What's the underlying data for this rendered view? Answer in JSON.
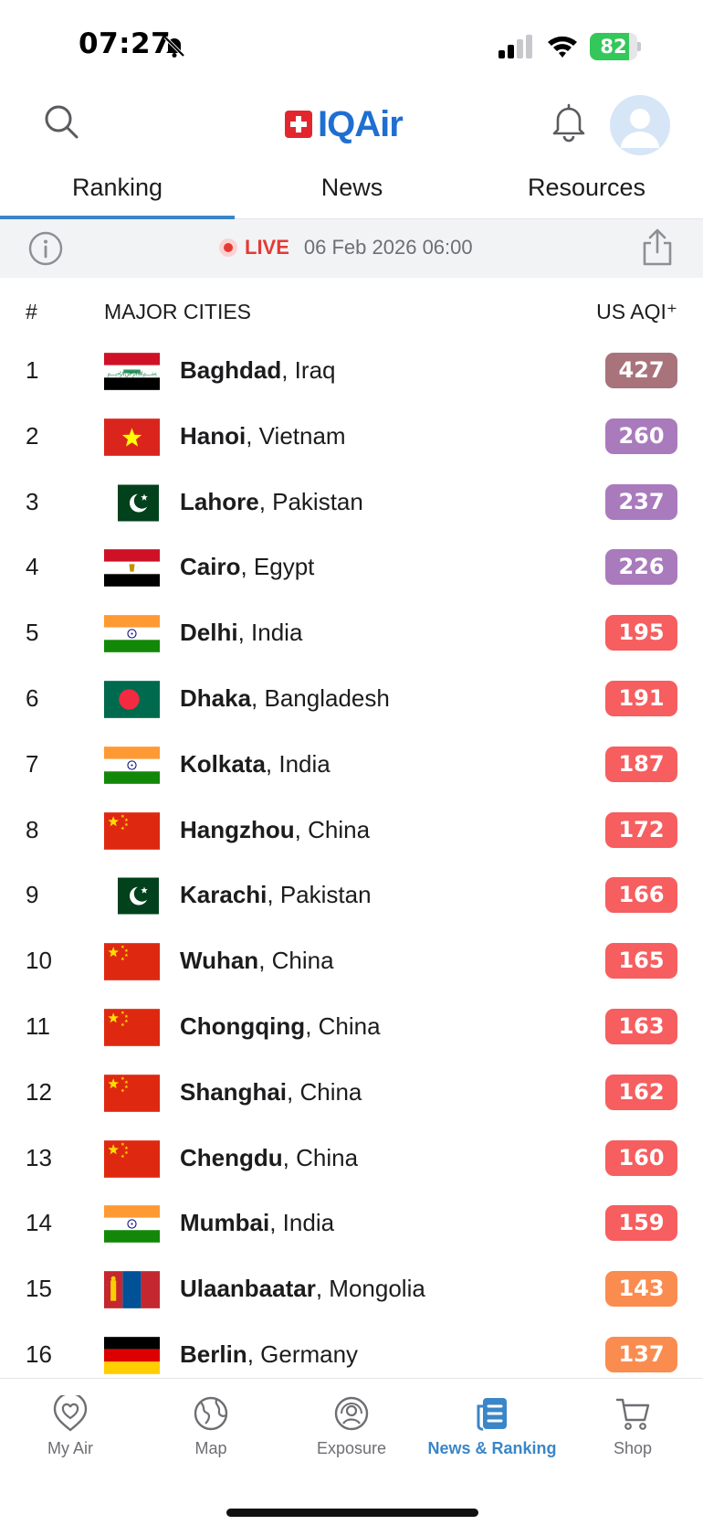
{
  "status_bar": {
    "time": "07:27",
    "battery": "82",
    "battery_level": 0.82,
    "icons": [
      "bell-slash-icon",
      "signal-icon",
      "wifi-icon",
      "battery-icon"
    ]
  },
  "header": {
    "logo_text": "IQAir",
    "icons": [
      "search-icon",
      "bell-icon",
      "avatar-icon"
    ]
  },
  "tabs": [
    {
      "label": "Ranking",
      "active": true
    },
    {
      "label": "News",
      "active": false
    },
    {
      "label": "Resources",
      "active": false
    }
  ],
  "live_bar": {
    "live_label": "LIVE",
    "datetime": "06 Feb 2026 06:00"
  },
  "table": {
    "col_rank": "#",
    "col_city": "MAJOR CITIES",
    "col_aqi": "US AQI⁺",
    "rows": [
      {
        "rank": "1",
        "city": "Baghdad",
        "country": ", Iraq",
        "aqi": "427",
        "color": "#a8737b",
        "flag": "iraq"
      },
      {
        "rank": "2",
        "city": "Hanoi",
        "country": ", Vietnam",
        "aqi": "260",
        "color": "#a97abc",
        "flag": "vietnam"
      },
      {
        "rank": "3",
        "city": "Lahore",
        "country": ", Pakistan",
        "aqi": "237",
        "color": "#a97abc",
        "flag": "pakistan"
      },
      {
        "rank": "4",
        "city": "Cairo",
        "country": ", Egypt",
        "aqi": "226",
        "color": "#a97abc",
        "flag": "egypt"
      },
      {
        "rank": "5",
        "city": "Delhi",
        "country": ", India",
        "aqi": "195",
        "color": "#f65e5f",
        "flag": "india"
      },
      {
        "rank": "6",
        "city": "Dhaka",
        "country": ", Bangladesh",
        "aqi": "191",
        "color": "#f65e5f",
        "flag": "bangladesh"
      },
      {
        "rank": "7",
        "city": "Kolkata",
        "country": ", India",
        "aqi": "187",
        "color": "#f65e5f",
        "flag": "india"
      },
      {
        "rank": "8",
        "city": "Hangzhou",
        "country": ", China",
        "aqi": "172",
        "color": "#f65e5f",
        "flag": "china"
      },
      {
        "rank": "9",
        "city": "Karachi",
        "country": ", Pakistan",
        "aqi": "166",
        "color": "#f65e5f",
        "flag": "pakistan"
      },
      {
        "rank": "10",
        "city": "Wuhan",
        "country": ", China",
        "aqi": "165",
        "color": "#f65e5f",
        "flag": "china"
      },
      {
        "rank": "11",
        "city": "Chongqing",
        "country": ", China",
        "aqi": "163",
        "color": "#f65e5f",
        "flag": "china"
      },
      {
        "rank": "12",
        "city": "Shanghai",
        "country": ", China",
        "aqi": "162",
        "color": "#f65e5f",
        "flag": "china"
      },
      {
        "rank": "13",
        "city": "Chengdu",
        "country": ", China",
        "aqi": "160",
        "color": "#f65e5f",
        "flag": "china"
      },
      {
        "rank": "14",
        "city": "Mumbai",
        "country": ", India",
        "aqi": "159",
        "color": "#f65e5f",
        "flag": "india"
      },
      {
        "rank": "15",
        "city": "Ulaanbaatar",
        "country": ", Mongolia",
        "aqi": "143",
        "color": "#fa8c4f",
        "flag": "mongolia"
      },
      {
        "rank": "16",
        "city": "Berlin",
        "country": ", Germany",
        "aqi": "137",
        "color": "#fa8c4f",
        "flag": "germany"
      }
    ]
  },
  "bottom_nav": [
    {
      "label": "My Air",
      "icon": "heart-pin-icon",
      "active": false
    },
    {
      "label": "Map",
      "icon": "globe-icon",
      "active": false
    },
    {
      "label": "Exposure",
      "icon": "exposure-icon",
      "active": false
    },
    {
      "label": "News & Ranking",
      "icon": "news-icon",
      "active": true
    },
    {
      "label": "Shop",
      "icon": "cart-icon",
      "active": false
    }
  ],
  "colors": {
    "accent": "#3a86c8",
    "live_red": "#e53935",
    "aqi_maroon": "#a8737b",
    "aqi_purple": "#a97abc",
    "aqi_red": "#f65e5f",
    "aqi_orange": "#fa8c4f"
  }
}
